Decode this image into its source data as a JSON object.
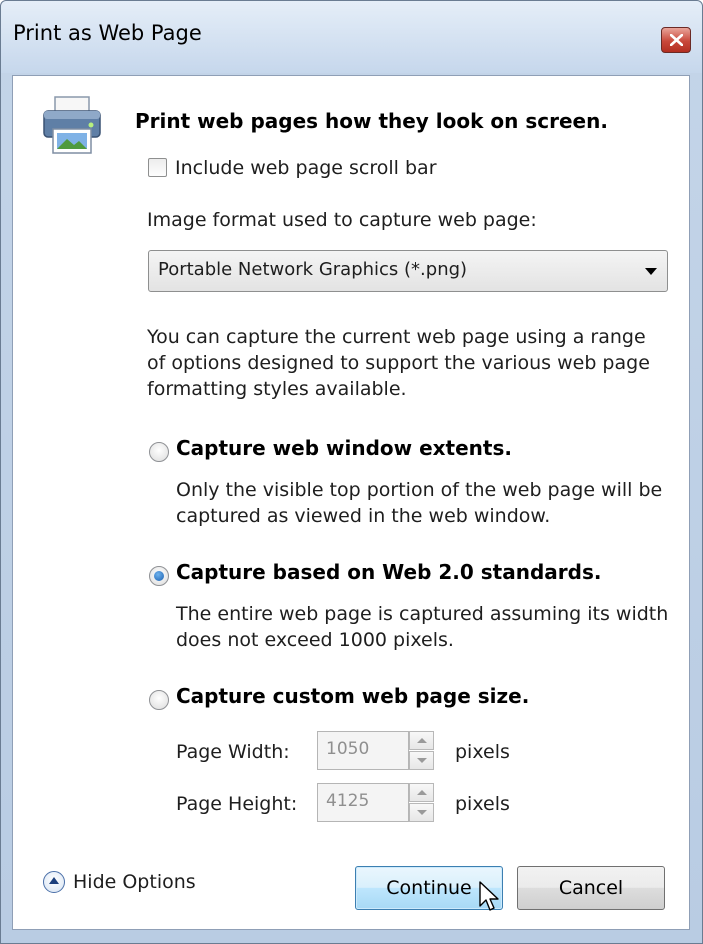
{
  "window": {
    "title": "Print as Web Page"
  },
  "header": {
    "text": "Print web pages how they look on screen."
  },
  "scrollbar_option": {
    "label": "Include web page scroll bar",
    "checked": false
  },
  "format": {
    "label": "Image format used to capture web page:",
    "selected": "Portable Network Graphics (*.png)"
  },
  "description": [
    "You can capture the current web page using a range",
    "of options designed to support the various web page",
    "formatting styles available."
  ],
  "options": [
    {
      "label": "Capture web window extents.",
      "selected": false,
      "desc": [
        "Only the visible top portion of the web page will be",
        "captured as viewed in the web window."
      ]
    },
    {
      "label": "Capture based on Web 2.0 standards.",
      "selected": true,
      "desc": [
        "The entire web page is captured assuming its width",
        "does not exceed 1000 pixels."
      ]
    },
    {
      "label": "Capture custom web page size.",
      "selected": false,
      "desc": []
    }
  ],
  "custom_size": {
    "width": {
      "label": "Page Width:",
      "value": "1050",
      "unit": "pixels"
    },
    "height": {
      "label": "Page Height:",
      "value": "4125",
      "unit": "pixels"
    }
  },
  "footer": {
    "hide_options": "Hide Options",
    "continue": "Continue",
    "cancel": "Cancel"
  }
}
